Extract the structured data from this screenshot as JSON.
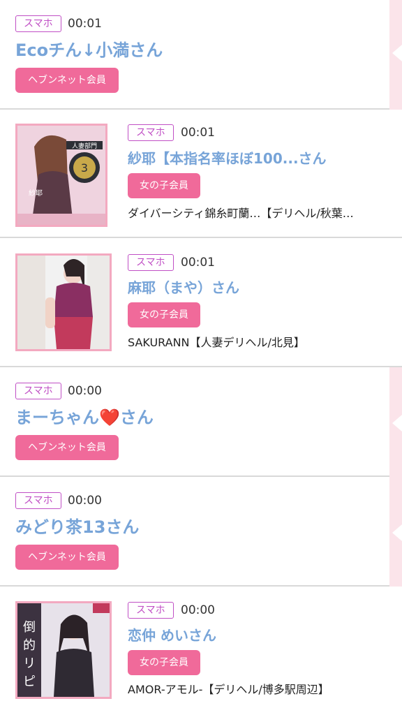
{
  "items": [
    {
      "type": "text",
      "badge": "スマホ",
      "time": "00:01",
      "name": "Ecoチん↓小満さん",
      "member": "ヘブンネット会員"
    },
    {
      "type": "photo",
      "badge": "スマホ",
      "time": "00:01",
      "name": "紗耶【本指名率ほぼ100...さん",
      "member": "女の子会員",
      "shop": "ダイバーシティ錦糸町蘭…【デリヘル/秋葉…",
      "thumb_label": "人妻部門"
    },
    {
      "type": "photo",
      "badge": "スマホ",
      "time": "00:01",
      "name": "麻耶（まや）さん",
      "member": "女の子会員",
      "shop": "SAKURANN【人妻デリヘル/北見】"
    },
    {
      "type": "text",
      "badge": "スマホ",
      "time": "00:00",
      "name": "まーちゃん❤️さん",
      "member": "ヘブンネット会員"
    },
    {
      "type": "text",
      "badge": "スマホ",
      "time": "00:00",
      "name": "みどり茶13さん",
      "member": "ヘブンネット会員"
    },
    {
      "type": "photo",
      "badge": "スマホ",
      "time": "00:00",
      "name": "恋仲 めいさん",
      "member": "女の子会員",
      "shop": "AMOR-アモル-【デリヘル/博多駅周辺】",
      "thumb_label": "倒的リピート"
    }
  ],
  "colors": {
    "badge": "#c04fc5",
    "name": "#77a4d8",
    "pill": "#f06a9a",
    "thumb_border": "#f3a9c0",
    "side_strip": "#fbe4ea"
  }
}
